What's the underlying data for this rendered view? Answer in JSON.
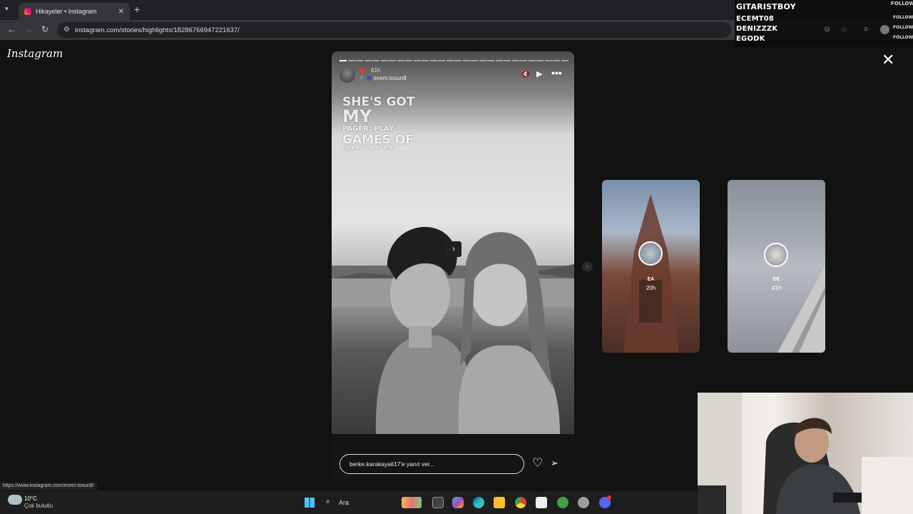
{
  "browser": {
    "tab_title": "Hikayeler • Instagram",
    "url": "instagram.com/stories/highlights/18286766947221637/"
  },
  "overlay": {
    "top_name": "GITARISTBOY",
    "names": [
      "ECEMT08",
      "DENIZZZK",
      "EGODK"
    ],
    "follow_label": "FOLLOW"
  },
  "instagram": {
    "logo": "Instagram",
    "story": {
      "time": "61h",
      "username": "ecem.tosun8",
      "overlay_lines": [
        "SHE'S GOT",
        "MY",
        "PAGER, PLAY",
        "GAMES OF",
        "LOVE ALL ON MY EYES"
      ],
      "reply_placeholder": "berke.karakayali17'e yanıt ver..."
    },
    "side_stories": [
      {
        "label": "EA",
        "time": "20h"
      },
      {
        "label": "DE",
        "time": "41h"
      }
    ]
  },
  "status_url": "https://www.instagram.com/ecem.tosun8/",
  "taskbar": {
    "weather_temp": "10°C",
    "weather_desc": "Çok bulutlu",
    "search_label": "Ara"
  },
  "colors": {
    "page_bg": "#121212",
    "story_bg": "#1a1a1a",
    "notification_dot": "#e53935"
  }
}
